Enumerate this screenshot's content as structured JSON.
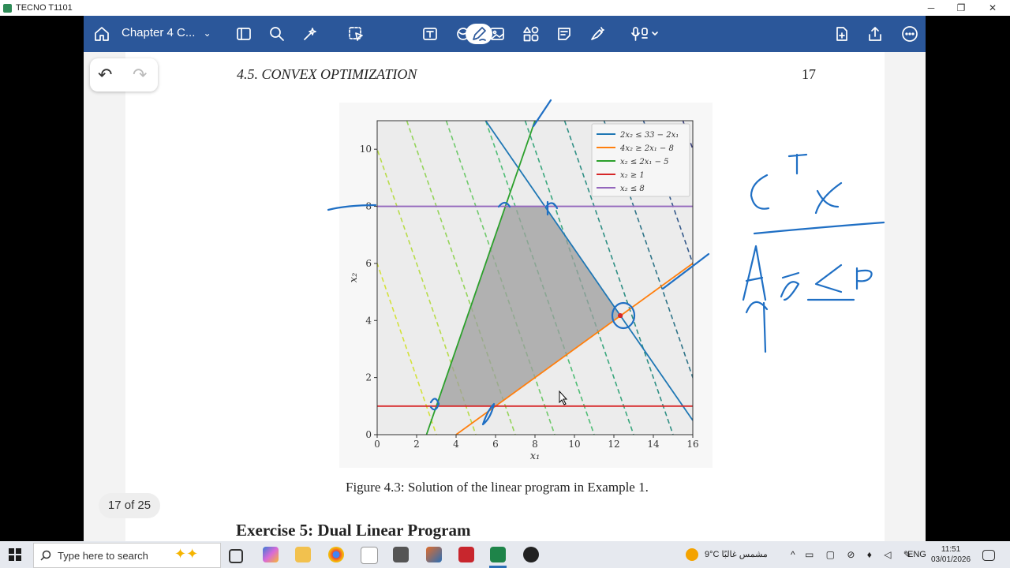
{
  "window": {
    "title": "TECNO T1101",
    "minimize": "─",
    "restore": "❐",
    "close": "✕"
  },
  "toolbar": {
    "doc_title": "Chapter 4 C..."
  },
  "page": {
    "running_head": "4.5.  CONVEX OPTIMIZATION",
    "page_number": "17",
    "caption": "Figure 4.3: Solution of the linear program in Example 1.",
    "next_heading": "Exercise 5: Dual Linear Program",
    "indicator": "17 of 25"
  },
  "undo": {
    "undo_label": "↶",
    "redo_label": "↷"
  },
  "chart_data": {
    "type": "line",
    "xlabel": "x₁",
    "ylabel": "x₂",
    "xlim": [
      0,
      16
    ],
    "ylim": [
      0,
      11
    ],
    "xticks": [
      "0",
      "2",
      "4",
      "6",
      "8",
      "10",
      "12",
      "14",
      "16"
    ],
    "yticks": [
      "0",
      "2",
      "4",
      "6",
      "8",
      "10"
    ],
    "legend_position": "top-right",
    "series": [
      {
        "name": "2x₂ ≤ 33 − 2x₁",
        "color": "#1f77b4",
        "x": [
          5.5,
          16.0
        ],
        "y": [
          11.0,
          0.5
        ]
      },
      {
        "name": "4x₂ ≥ 2x₁ − 8",
        "color": "#ff7f0e",
        "x": [
          4.0,
          16.0
        ],
        "y": [
          0.0,
          6.0
        ]
      },
      {
        "name": "x₂ ≤ 2x₁ − 5",
        "color": "#2ca02c",
        "x": [
          2.5,
          8.0
        ],
        "y": [
          0.0,
          11.0
        ]
      },
      {
        "name": "x₂ ≥ 1",
        "color": "#d62728",
        "x": [
          0,
          16
        ],
        "y": [
          1,
          1
        ]
      },
      {
        "name": "x₂ ≤ 8",
        "color": "#9467bd",
        "x": [
          0,
          16
        ],
        "y": [
          8,
          8
        ]
      }
    ],
    "feasible_region": [
      [
        3,
        1
      ],
      [
        6,
        1
      ],
      [
        12.33,
        4.17
      ],
      [
        8.5,
        8
      ],
      [
        6.5,
        8
      ]
    ],
    "optimum": [
      12.33,
      4.17
    ]
  },
  "taskbar": {
    "search_placeholder": "Type here to search",
    "weather": "9°C  مشمس غالبًا",
    "lang": "ENG",
    "time": "11:51",
    "date": "03/01/2026"
  }
}
